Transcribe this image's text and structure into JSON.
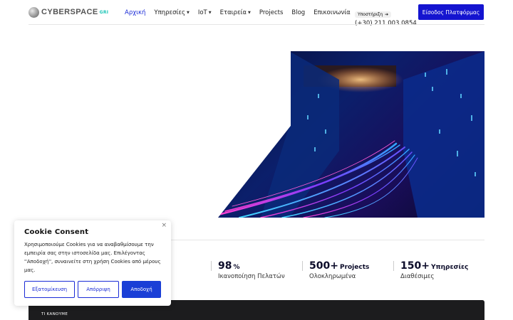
{
  "header": {
    "logo_text": "CYBERSPACE",
    "logo_sub": "GRI",
    "nav": [
      {
        "label": "Αρχική",
        "active": true,
        "has_dropdown": false
      },
      {
        "label": "Υπηρεσίες",
        "active": false,
        "has_dropdown": true
      },
      {
        "label": "IoT",
        "active": false,
        "has_dropdown": true
      },
      {
        "label": "Εταιρεία",
        "active": false,
        "has_dropdown": true
      },
      {
        "label": "Projects",
        "active": false,
        "has_dropdown": false
      },
      {
        "label": "Blog",
        "active": false,
        "has_dropdown": false
      },
      {
        "label": "Επικοινωνία",
        "active": false,
        "has_dropdown": false
      }
    ],
    "support_label": "Υποστήριξη",
    "support_phone": "(+30) 211 003 0854",
    "login_label": "Είσοδος Πλατφόρμας"
  },
  "stats": [
    {
      "number": "98",
      "unit": "%",
      "label": "Ικανοποίηση Πελατών"
    },
    {
      "number": "500+",
      "unit": "Projects",
      "label": "Ολοκληρωμένα"
    },
    {
      "number": "150+",
      "unit": "Υπηρεσίες",
      "label": "Διαθέσιμες"
    }
  ],
  "section": {
    "label": "ΤΙ ΚΑΝΟΥΜΕ"
  },
  "cookie": {
    "title": "Cookie Consent",
    "text": "Χρησιμοποιούμε Cookies για να αναβαθμίσουμε την εμπειρία σας στην ιστοσελίδα μας. Επιλέγοντας ''Αποδοχή'', συναινείτε στη χρήση Cookies από μέρους μας.",
    "close_symbol": "×",
    "customize_label": "Εξατομίκευση",
    "reject_label": "Απόρριψη",
    "accept_label": "Αποδοχή"
  },
  "icons": {
    "caret": "▼",
    "arrow": "➔"
  },
  "colors": {
    "brand_blue": "#1414d0",
    "nav_active": "#1a2bd6",
    "logo_accent": "#1ec6b7"
  }
}
